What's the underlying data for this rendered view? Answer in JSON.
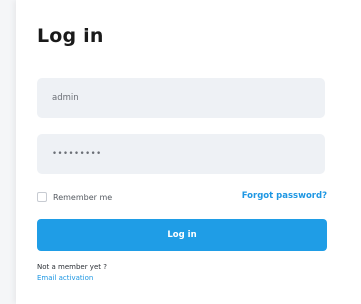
{
  "login": {
    "title": "Log in",
    "username_value": "admin",
    "password_value": "•••••••••",
    "remember_label": "Remember me",
    "forgot_label": "Forgot password?",
    "submit_label": "Log in",
    "member_text": "Not a member yet ?",
    "activation_label": "Email activation"
  },
  "colors": {
    "accent": "#1f9de6",
    "link": "#1e97e3",
    "field_bg": "#eef1f5"
  }
}
